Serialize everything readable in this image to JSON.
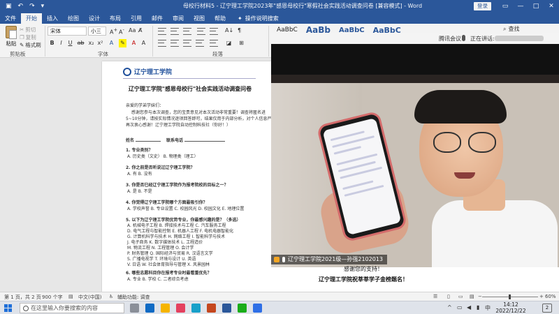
{
  "titlebar": {
    "title": "母校行材料5 - 辽宁理工学院2023年\"感恩母校行\"寒假社会实践活动调查问卷 [兼容模式] - Word",
    "login": "登录"
  },
  "menu": {
    "tabs": [
      "文件",
      "开始",
      "插入",
      "绘图",
      "设计",
      "布局",
      "引用",
      "邮件",
      "审阅",
      "视图",
      "帮助"
    ],
    "tellme": "操作说明搜索"
  },
  "ribbon": {
    "paste": "粘贴",
    "cut": "剪切",
    "copy": "复制",
    "format_painter": "格式刷",
    "clipboard_group": "剪贴板",
    "font_name": "宋体",
    "font_size": "小三",
    "font_group": "字体",
    "paragraph_group": "段落",
    "styles_preview": [
      "AaBbC",
      "AaBb",
      "AaBbC",
      "AaBbC"
    ],
    "find": "查找"
  },
  "document": {
    "logo_text": "辽宁理工学院",
    "title": "辽宁理工学院\"感恩母校行\"社会实践活动调查问卷",
    "greeting": "亲爱的学弟学妹们：",
    "intro1": "感谢您参与本次调查，您的宝贵意见对本次活动非常重要！调查将",
    "intro_link": "匿名进",
    "intro2": "5~10分钟，请按实际情况逐项回答即可，结果仅用于内部分析，对个人信息严格保密。",
    "intro3": "再次衷心感谢！辽宁理工学院自动控制科技社（你好！）",
    "name_label": "姓名",
    "phone_label": "联系电话",
    "q1": "1. 专业类别？",
    "q1_opts": "A. 历史类（文史）    B. 物理类（理工）",
    "q2": "2. 你之前是否听说过辽宁理工学院？",
    "q2_opts": "A. 有    B. 没有",
    "q3": "3. 你是否已经辽宁理工学院作为报考院校的目标之一？",
    "q3_opts": "A. 是    B. 不是",
    "q4": "4. 你觉得辽宁理工学院哪个方面最吸引你？",
    "q4_opts": "A. 学校声誉   B. 专业设置   C. 校园风光   D. 校园文化   E. 地理位置",
    "q5": "5. 以下为辽宁理工学院优势专业，你最感兴趣的是？（多选）",
    "q5_rows": [
      "A. 机械电子工程     B. 焊接技术与工程     C. 汽车服务工程",
      "D. 电气工程与智能控制   E. 机器人工程     F. 电机电器智能化",
      "G. 计算机科学与技术   H. 网络工程       I. 智能科学与技术",
      "J. 电子商务       K. 数字媒体技术     L. 工程造价",
      "M. 物流工程       N. 工程管理       O. 会计学",
      "P. 财务管理       Q. 国际经济与贸易    R. 汉语言文学",
      "S. 广播电视学      T. 环境与设计      U. 英语",
      "V. 日语         W. 社会体育指导与管理  X. 风景园林"
    ],
    "q6": "6. 哪些志愿科目你在报考专业时最看重优先？",
    "q6_opts": "A. 专业   B. 学校   C. 二者综合考虑"
  },
  "meeting": {
    "app_name": "腾讯会议",
    "speaking_label": "正在讲话:",
    "participant": "辽宁理工学院2021级—孙强2102013"
  },
  "closing": {
    "thanks": "感谢您的支持！",
    "slogan": "辽宁理工学院祝莘莘学子金榜题名！"
  },
  "statusbar": {
    "page": "第 1 页，共 2 页",
    "words": "900 个字",
    "lang": "中文(中国)",
    "accessibility": "辅助功能: 调查",
    "zoom": "60%"
  },
  "taskbar": {
    "search_placeholder": "在这里输入你要搜索的内容",
    "time": "14:12",
    "date": "2022/12/22",
    "ime": "中",
    "notification_count": "2"
  },
  "colors": {
    "word_blue": "#2b579a",
    "accent_link": "#1f4f9b"
  }
}
